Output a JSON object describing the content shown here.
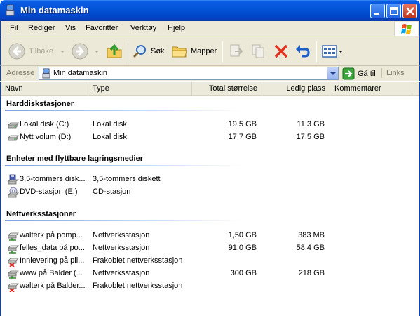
{
  "window": {
    "title": "Min datamaskin"
  },
  "menu": [
    "Fil",
    "Rediger",
    "Vis",
    "Favoritter",
    "Verktøy",
    "Hjelp"
  ],
  "toolbar": {
    "back_label": "Tilbake",
    "search_label": "Søk",
    "folders_label": "Mapper"
  },
  "address": {
    "label": "Adresse",
    "value": "Min datamaskin",
    "go_label": "Gå til",
    "links_label": "Links"
  },
  "columns": {
    "name": "Navn",
    "type": "Type",
    "total": "Total størrelse",
    "free": "Ledig plass",
    "comments": "Kommentarer"
  },
  "groups": [
    {
      "title": "Harddiskstasjoner",
      "items": [
        {
          "name": "Lokal disk (C:)",
          "type": "Lokal disk",
          "total": "19,5 GB",
          "free": "11,3 GB",
          "icon": "hard-drive-icon"
        },
        {
          "name": "Nytt volum (D:)",
          "type": "Lokal disk",
          "total": "17,7 GB",
          "free": "17,5 GB",
          "icon": "hard-drive-icon"
        }
      ]
    },
    {
      "title": "Enheter med flyttbare lagringsmedier",
      "items": [
        {
          "name": "3,5-tommers disk...",
          "type": "3,5-tommers diskett",
          "total": "",
          "free": "",
          "icon": "floppy-drive-icon"
        },
        {
          "name": "DVD-stasjon (E:)",
          "type": "CD-stasjon",
          "total": "",
          "free": "",
          "icon": "dvd-drive-icon"
        }
      ]
    },
    {
      "title": "Nettverksstasjoner",
      "items": [
        {
          "name": "walterk på pomp...",
          "type": "Nettverksstasjon",
          "total": "1,50 GB",
          "free": "383 MB",
          "icon": "network-drive-icon"
        },
        {
          "name": "felles_data på po...",
          "type": "Nettverksstasjon",
          "total": "91,0 GB",
          "free": "58,4 GB",
          "icon": "network-drive-icon"
        },
        {
          "name": "Innlevering på pil...",
          "type": "Frakoblet nettverksstasjon",
          "total": "",
          "free": "",
          "icon": "disconnected-network-drive-icon"
        },
        {
          "name": "www på Balder (...",
          "type": "Nettverksstasjon",
          "total": "300 GB",
          "free": "218 GB",
          "icon": "network-drive-icon"
        },
        {
          "name": "walterk på Balder...",
          "type": "Frakoblet nettverksstasjon",
          "total": "",
          "free": "",
          "icon": "disconnected-network-drive-icon"
        }
      ]
    }
  ]
}
